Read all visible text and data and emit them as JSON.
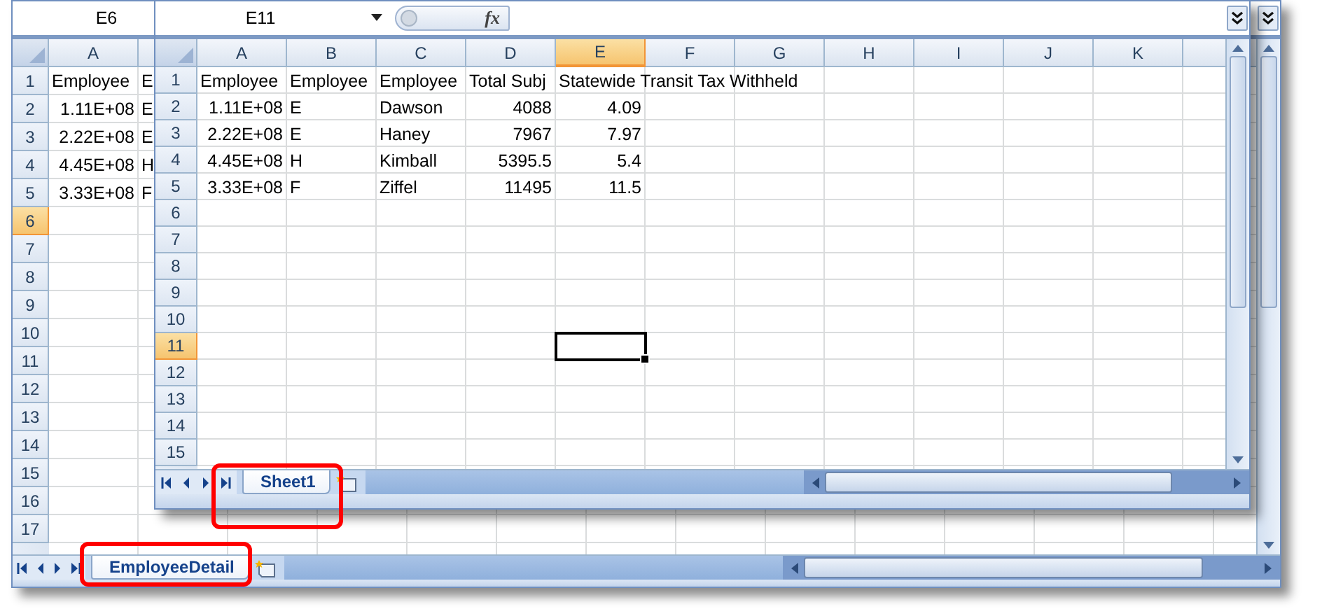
{
  "windows": [
    {
      "name_box": "E6",
      "columns": [
        {
          "label": "A",
          "selected": false
        }
      ],
      "rows": [
        {
          "label": "1",
          "selected": false,
          "cells": [
            {
              "text": "Employee",
              "kind": "text"
            },
            {
              "text": "E",
              "kind": "text"
            }
          ]
        },
        {
          "label": "2",
          "selected": false,
          "cells": [
            {
              "text": "1.11E+08",
              "kind": "number"
            },
            {
              "text": "E",
              "kind": "text"
            }
          ]
        },
        {
          "label": "3",
          "selected": false,
          "cells": [
            {
              "text": "2.22E+08",
              "kind": "number"
            },
            {
              "text": "E",
              "kind": "text"
            }
          ]
        },
        {
          "label": "4",
          "selected": false,
          "cells": [
            {
              "text": "4.45E+08",
              "kind": "number"
            },
            {
              "text": "H",
              "kind": "text"
            }
          ]
        },
        {
          "label": "5",
          "selected": false,
          "cells": [
            {
              "text": "3.33E+08",
              "kind": "number"
            },
            {
              "text": "F",
              "kind": "text"
            }
          ]
        },
        {
          "label": "6",
          "selected": true,
          "cells": []
        },
        {
          "label": "7",
          "selected": false,
          "cells": []
        },
        {
          "label": "8",
          "selected": false,
          "cells": []
        },
        {
          "label": "9",
          "selected": false,
          "cells": []
        },
        {
          "label": "10",
          "selected": false,
          "cells": []
        },
        {
          "label": "11",
          "selected": false,
          "cells": []
        },
        {
          "label": "12",
          "selected": false,
          "cells": []
        },
        {
          "label": "13",
          "selected": false,
          "cells": []
        },
        {
          "label": "14",
          "selected": false,
          "cells": []
        },
        {
          "label": "15",
          "selected": false,
          "cells": []
        },
        {
          "label": "16",
          "selected": false,
          "cells": []
        },
        {
          "label": "17",
          "selected": false,
          "cells": []
        }
      ],
      "sheet_tabs": [
        {
          "label": "EmployeeDetail",
          "selected": true,
          "annotated": true
        }
      ]
    },
    {
      "name_box": "E11",
      "formula_button": "fx",
      "columns": [
        {
          "label": "A",
          "selected": false
        },
        {
          "label": "B",
          "selected": false
        },
        {
          "label": "C",
          "selected": false
        },
        {
          "label": "D",
          "selected": false
        },
        {
          "label": "E",
          "selected": true
        },
        {
          "label": "F",
          "selected": false
        },
        {
          "label": "G",
          "selected": false
        },
        {
          "label": "H",
          "selected": false
        },
        {
          "label": "I",
          "selected": false
        },
        {
          "label": "J",
          "selected": false
        },
        {
          "label": "K",
          "selected": false
        }
      ],
      "rows": [
        {
          "label": "1",
          "selected": false,
          "cells": [
            {
              "text": "Employee",
              "kind": "text"
            },
            {
              "text": "Employee",
              "kind": "text"
            },
            {
              "text": "Employee",
              "kind": "text"
            },
            {
              "text": "Total Subj",
              "kind": "text"
            },
            {
              "text": "Statewide Transit Tax Withheld",
              "kind": "text"
            }
          ]
        },
        {
          "label": "2",
          "selected": false,
          "cells": [
            {
              "text": "1.11E+08",
              "kind": "number"
            },
            {
              "text": "E",
              "kind": "text"
            },
            {
              "text": "Dawson",
              "kind": "text"
            },
            {
              "text": "4088",
              "kind": "number"
            },
            {
              "text": "4.09",
              "kind": "number"
            }
          ]
        },
        {
          "label": "3",
          "selected": false,
          "cells": [
            {
              "text": "2.22E+08",
              "kind": "number"
            },
            {
              "text": "E",
              "kind": "text"
            },
            {
              "text": "Haney",
              "kind": "text"
            },
            {
              "text": "7967",
              "kind": "number"
            },
            {
              "text": "7.97",
              "kind": "number"
            }
          ]
        },
        {
          "label": "4",
          "selected": false,
          "cells": [
            {
              "text": "4.45E+08",
              "kind": "number"
            },
            {
              "text": "H",
              "kind": "text"
            },
            {
              "text": "Kimball",
              "kind": "text"
            },
            {
              "text": "5395.5",
              "kind": "number"
            },
            {
              "text": "5.4",
              "kind": "number"
            }
          ]
        },
        {
          "label": "5",
          "selected": false,
          "cells": [
            {
              "text": "3.33E+08",
              "kind": "number"
            },
            {
              "text": "F",
              "kind": "text"
            },
            {
              "text": "Ziffel",
              "kind": "text"
            },
            {
              "text": "11495",
              "kind": "number"
            },
            {
              "text": "11.5",
              "kind": "number"
            }
          ]
        },
        {
          "label": "6",
          "selected": false,
          "cells": []
        },
        {
          "label": "7",
          "selected": false,
          "cells": []
        },
        {
          "label": "8",
          "selected": false,
          "cells": []
        },
        {
          "label": "9",
          "selected": false,
          "cells": []
        },
        {
          "label": "10",
          "selected": false,
          "cells": []
        },
        {
          "label": "11",
          "selected": true,
          "cells": []
        },
        {
          "label": "12",
          "selected": false,
          "cells": []
        },
        {
          "label": "13",
          "selected": false,
          "cells": []
        },
        {
          "label": "14",
          "selected": false,
          "cells": []
        },
        {
          "label": "15",
          "selected": false,
          "cells": []
        }
      ],
      "sheet_tabs": [
        {
          "label": "Sheet1",
          "selected": true,
          "annotated": true
        }
      ]
    }
  ]
}
